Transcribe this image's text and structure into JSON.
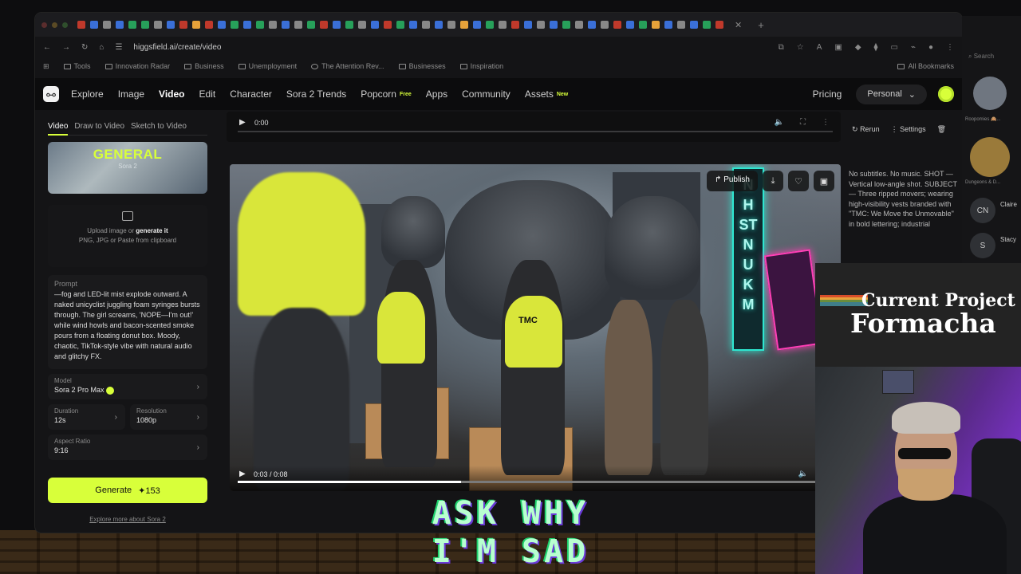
{
  "browser": {
    "url": "higgsfield.ai/create/video",
    "bookmarks": [
      "Tools",
      "Innovation Radar",
      "Business",
      "Unemployment",
      "The Attention Rev...",
      "Businesses",
      "Inspiration"
    ],
    "all_bookmarks": "All Bookmarks"
  },
  "site": {
    "nav": [
      {
        "label": "Explore",
        "active": false
      },
      {
        "label": "Image",
        "active": false
      },
      {
        "label": "Video",
        "active": true
      },
      {
        "label": "Edit",
        "active": false
      },
      {
        "label": "Character",
        "active": false
      },
      {
        "label": "Sora 2 Trends",
        "active": false
      },
      {
        "label": "Popcorn",
        "tag": "Free"
      },
      {
        "label": "Apps"
      },
      {
        "label": "Community"
      },
      {
        "label": "Assets",
        "tag": "New"
      }
    ],
    "pricing": "Pricing",
    "workspace": "Personal"
  },
  "left": {
    "tabs": [
      "Video",
      "Draw to Video",
      "Sketch to Video"
    ],
    "card_title": "GENERAL",
    "card_sub": "Sora 2",
    "upload_text": "Upload image or",
    "upload_link": "generate it",
    "upload_hint": "PNG, JPG or Paste from clipboard",
    "prompt_label": "Prompt",
    "prompt_text": "—fog and LED-lit mist explode outward. A naked unicyclist juggling foam syringes bursts through. The girl screams, 'NOPE—I'm out!' while wind howls and bacon-scented smoke pours from a floating donut box. Moody, chaotic, TikTok-style vibe with natural audio and glitchy FX.",
    "model_label": "Model",
    "model_value": "Sora 2 Pro Max",
    "duration_label": "Duration",
    "duration_value": "12s",
    "resolution_label": "Resolution",
    "resolution_value": "1080p",
    "aspect_label": "Aspect Ratio",
    "aspect_value": "9:16",
    "generate_label": "Generate",
    "generate_cost": "153",
    "explore_more": "Explore more about Sora 2"
  },
  "audio": {
    "time": "0:00"
  },
  "actions": {
    "rerun": "Rerun",
    "settings": "Settings"
  },
  "video": {
    "publish": "Publish",
    "time": "0:03 / 0:08",
    "progress": 0.375,
    "vest_text": "TMC",
    "sign_text": "NHSTNUKM"
  },
  "description": "No subtitles. No music. SHOT — Vertical low-angle shot. SUBJECT — Three ripped movers; wearing high-visibility vests branded with \"TMC: We Move the Unmovable\" in bold lettering; industrial",
  "sidebar_right": {
    "search": "Search",
    "contacts": [
      "CN",
      "S"
    ],
    "names": [
      "Claire",
      "Stacy"
    ],
    "labels": [
      "Roopomies 🙈...",
      "Dungeons & D..."
    ]
  },
  "overlay": {
    "current_project": "Current Project",
    "project_name": "Formacha",
    "caption_line1": "ASK WHY",
    "caption_line2": "I'M SAD"
  }
}
